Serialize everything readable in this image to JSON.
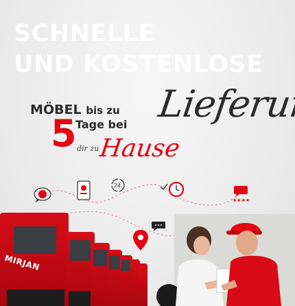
{
  "headline": {
    "line1": "SCHNELLE",
    "line2": "UND KOSTENLOSE",
    "script_word": "Lieferung"
  },
  "offer": {
    "moebel": "MÖBEL",
    "bis_zu": "bis zu",
    "number": "5",
    "tage_bei": "Tage bei",
    "dir_zu": "dir zu",
    "hause": "Hause"
  },
  "trucks": {
    "brand": "MIRJAN"
  },
  "colors": {
    "accent": "#e30613",
    "text_dark": "#2b2b2b",
    "headline": "#ffffff"
  },
  "icons": [
    "chat-bubble-icon",
    "phone-app-icon",
    "clock-24h-icon",
    "check-clock-icon",
    "rating-chat-icon",
    "map-pin-icon",
    "speech-bubble-icon"
  ]
}
